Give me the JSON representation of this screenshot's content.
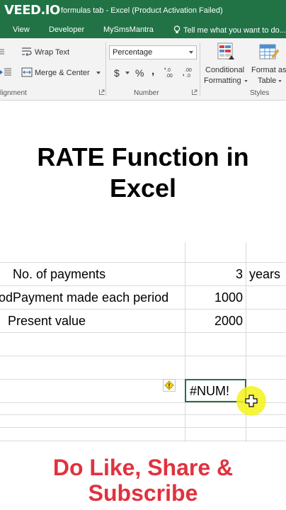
{
  "window": {
    "logo": "VEED.IO",
    "title": "formulas tab - Excel (Product Activation Failed)"
  },
  "tabs": [
    {
      "label": "View"
    },
    {
      "label": "Developer"
    },
    {
      "label": "MySmsMantra"
    }
  ],
  "tell_me": "Tell me what you want to do...",
  "ribbon": {
    "alignment": {
      "label": "lignment",
      "wrap_text": "Wrap Text",
      "merge_center": "Merge & Center"
    },
    "number": {
      "label": "Number",
      "format_value": "Percentage",
      "currency_symbol": "$",
      "percent_symbol": "%",
      "comma_symbol": ","
    },
    "styles": {
      "label": "Styles",
      "conditional_line1": "Conditional",
      "conditional_line2": "Formatting",
      "format_as_line1": "Format as",
      "format_as_line2": "Table"
    }
  },
  "overlay": {
    "title_line1": "RATE Function in",
    "title_line2": "Excel",
    "cta_line1": "Do Like, Share &",
    "cta_line2": "Subscribe"
  },
  "sheet": {
    "rows": [
      {
        "label": "No. of payments",
        "value": "3",
        "unit": "years"
      },
      {
        "label_prefix": "od",
        "label": "Payment made each period",
        "value": "1000"
      },
      {
        "label": "Present value",
        "value": "2000"
      }
    ],
    "result": "#NUM!"
  },
  "colors": {
    "excel_green": "#217346",
    "cta_red": "#e0323e",
    "cursor_highlight": "#f6f21a"
  }
}
